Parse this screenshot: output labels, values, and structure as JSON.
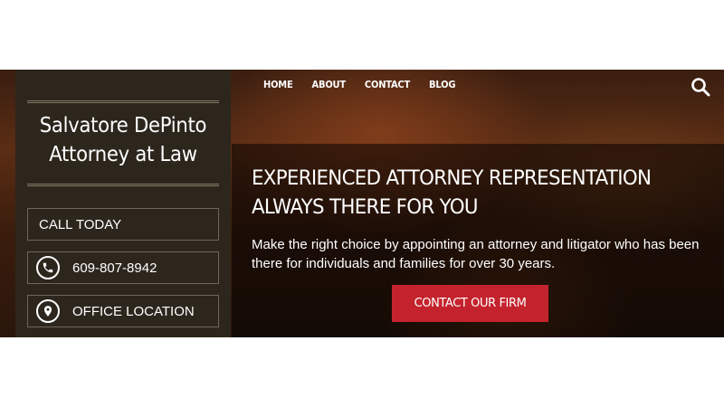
{
  "brand": {
    "line1": "Salvatore DePinto",
    "line2": "Attorney at Law"
  },
  "sidebar": {
    "call_today": "CALL TODAY",
    "phone": "609-807-8942",
    "office": "OFFICE LOCATION",
    "phone_icon": "phone-icon",
    "location_icon": "location-pin-icon"
  },
  "nav": {
    "items": [
      "HOME",
      "ABOUT",
      "CONTACT",
      "BLOG"
    ]
  },
  "search_icon": "search-icon",
  "hero": {
    "headline": "EXPERIENCED ATTORNEY REPRESENTATION ALWAYS THERE FOR YOU",
    "subtext": "Make the right choice by appointing an attorney and litigator who has been there for individuals and families for over 30 years.",
    "cta": "CONTACT OUR FIRM"
  },
  "colors": {
    "sidebar_bg": "#2c261d",
    "cta_bg": "#c4232d",
    "text": "#ffffff"
  }
}
